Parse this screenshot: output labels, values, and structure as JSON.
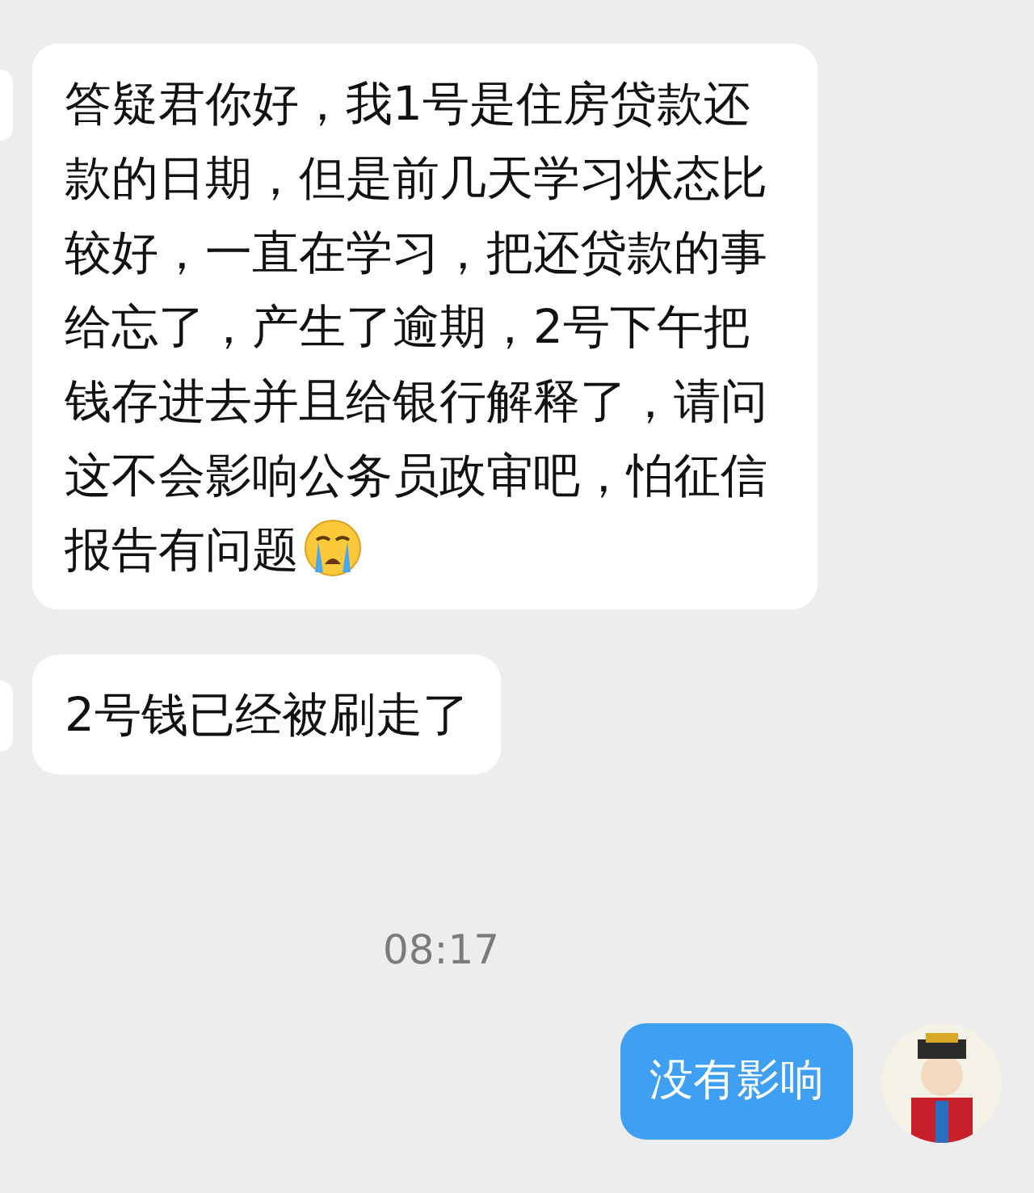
{
  "messages": [
    {
      "kind": "incoming",
      "text": "答疑君你好，我1号是住房贷款还款的日期，但是前几天学习状态比较好，一直在学习，把还贷款的事给忘了，产生了逾期，2号下午把钱存进去并且给银行解释了，请问这不会影响公务员政审吧，怕征信报告有问题",
      "emoji": true
    },
    {
      "kind": "incoming",
      "text": "2号钱已经被刷走了",
      "emoji": false
    },
    {
      "kind": "time",
      "text": "08:17"
    },
    {
      "kind": "outgoing",
      "text": "没有影响"
    }
  ]
}
